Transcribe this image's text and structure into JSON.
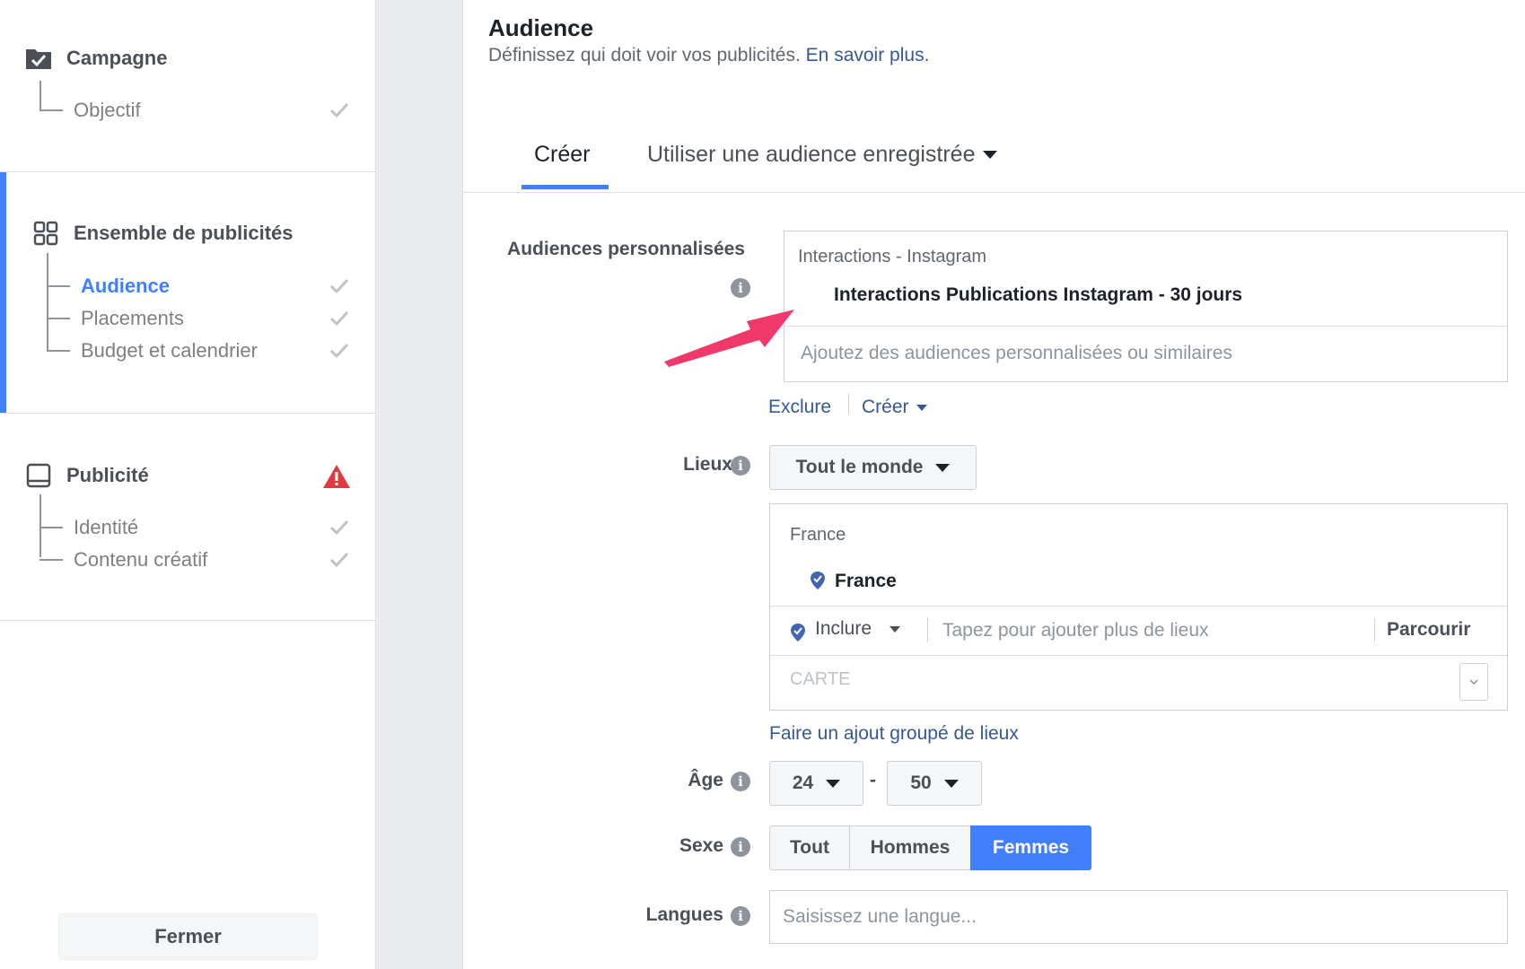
{
  "sidebar": {
    "campaign": {
      "title": "Campagne",
      "items": [
        {
          "label": "Objectif",
          "done": true
        }
      ]
    },
    "adset": {
      "title": "Ensemble de publicités",
      "items": [
        {
          "label": "Audience",
          "active": true,
          "done": true
        },
        {
          "label": "Placements",
          "done": true
        },
        {
          "label": "Budget et calendrier",
          "done": true
        }
      ]
    },
    "ad": {
      "title": "Publicité",
      "status": "warning",
      "items": [
        {
          "label": "Identité",
          "done": true
        },
        {
          "label": "Contenu créatif",
          "done": true
        }
      ]
    },
    "close_label": "Fermer"
  },
  "main": {
    "title": "Audience",
    "subtitle": "Définissez qui doit voir vos publicités.",
    "learn_more": "En savoir plus.",
    "tabs": [
      {
        "label": "Créer",
        "active": true
      },
      {
        "label": "Utiliser une audience enregistrée",
        "active": false
      }
    ],
    "custom_audiences": {
      "label": "Audiences personnalisées",
      "group_header": "Interactions - Instagram",
      "selected": "Interactions Publications Instagram - 30 jours",
      "placeholder": "Ajoutez des audiences personnalisées ou similaires",
      "exclude_label": "Exclure",
      "create_label": "Créer"
    },
    "locations": {
      "label": "Lieux",
      "dropdown_value": "Tout le monde",
      "group_header": "France",
      "selected": "France",
      "include_label": "Inclure",
      "placeholder": "Tapez pour ajouter plus de lieux",
      "browse_label": "Parcourir",
      "map_label": "CARTE",
      "bulk_link": "Faire un ajout groupé de lieux"
    },
    "age": {
      "label": "Âge",
      "min": "24",
      "separator": "-",
      "max": "50"
    },
    "gender": {
      "label": "Sexe",
      "options": [
        "Tout",
        "Hommes",
        "Femmes"
      ],
      "selected": "Femmes"
    },
    "languages": {
      "label": "Langues",
      "placeholder": "Saisissez une langue..."
    }
  },
  "colors": {
    "accent": "#4080ff",
    "link": "#365899",
    "arrow": "#f0386b",
    "warning": "#e0393e"
  }
}
